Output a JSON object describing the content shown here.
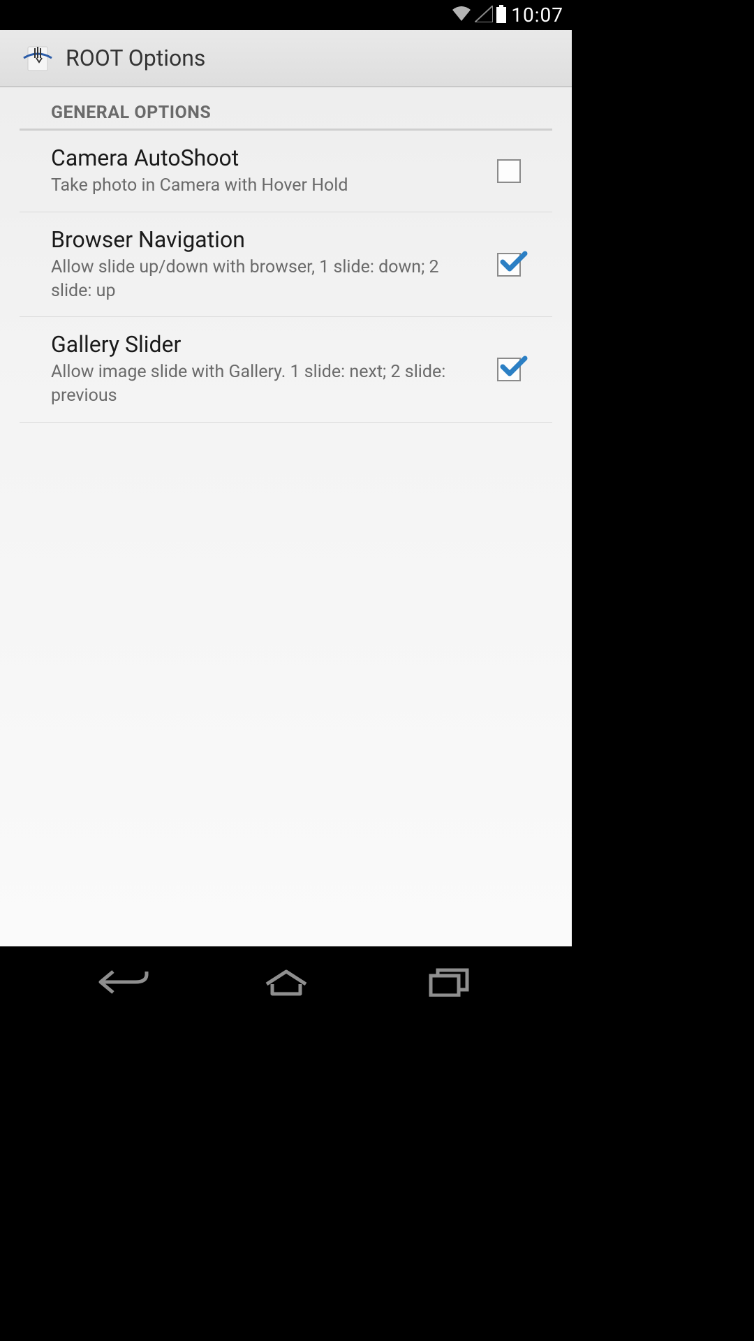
{
  "status": {
    "time": "10:07"
  },
  "header": {
    "title": "ROOT Options"
  },
  "section": {
    "title": "GENERAL OPTIONS"
  },
  "settings": [
    {
      "title": "Camera AutoShoot",
      "desc": "Take photo in Camera with Hover Hold",
      "checked": false
    },
    {
      "title": "Browser Navigation",
      "desc": "Allow slide up/down with browser, 1 slide: down; 2 slide: up",
      "checked": true
    },
    {
      "title": "Gallery Slider",
      "desc": "Allow image slide with Gallery. 1 slide: next; 2 slide: previous",
      "checked": true
    }
  ]
}
